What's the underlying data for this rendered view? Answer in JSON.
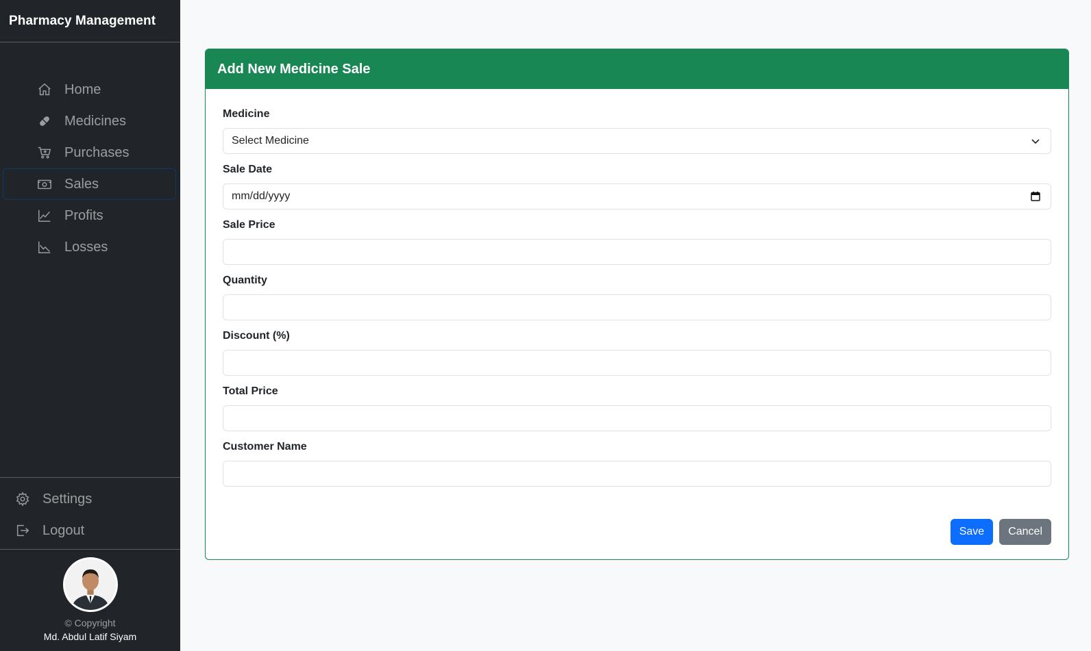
{
  "sidebar": {
    "brand": "Pharmacy Management",
    "items": [
      {
        "label": "Home",
        "icon": "house-icon"
      },
      {
        "label": "Medicines",
        "icon": "capsule-icon"
      },
      {
        "label": "Purchases",
        "icon": "cart-plus-icon"
      },
      {
        "label": "Sales",
        "icon": "cash-icon",
        "active": true
      },
      {
        "label": "Profits",
        "icon": "graph-up-icon"
      },
      {
        "label": "Losses",
        "icon": "graph-down-icon"
      }
    ],
    "bottom_items": [
      {
        "label": "Settings",
        "icon": "gear-icon"
      },
      {
        "label": "Logout",
        "icon": "logout-icon"
      }
    ],
    "copyright": "© Copyright",
    "author": "Md. Abdul Latif Siyam"
  },
  "form": {
    "title": "Add New Medicine Sale",
    "fields": [
      {
        "label": "Medicine",
        "value": "Select Medicine",
        "type": "select"
      },
      {
        "label": "Sale Date",
        "value": "mm/dd/yyyy",
        "type": "date"
      },
      {
        "label": "Sale Price",
        "value": "",
        "type": "text"
      },
      {
        "label": "Quantity",
        "value": "",
        "type": "text"
      },
      {
        "label": "Discount (%)",
        "value": "",
        "type": "text"
      },
      {
        "label": "Total Price",
        "value": "",
        "type": "text"
      },
      {
        "label": "Customer Name",
        "value": "",
        "type": "text"
      }
    ],
    "save_label": "Save",
    "cancel_label": "Cancel"
  },
  "colors": {
    "sidebar_bg": "#212529",
    "header_green": "#198754",
    "primary": "#0d6efd",
    "secondary": "#6c757d"
  }
}
